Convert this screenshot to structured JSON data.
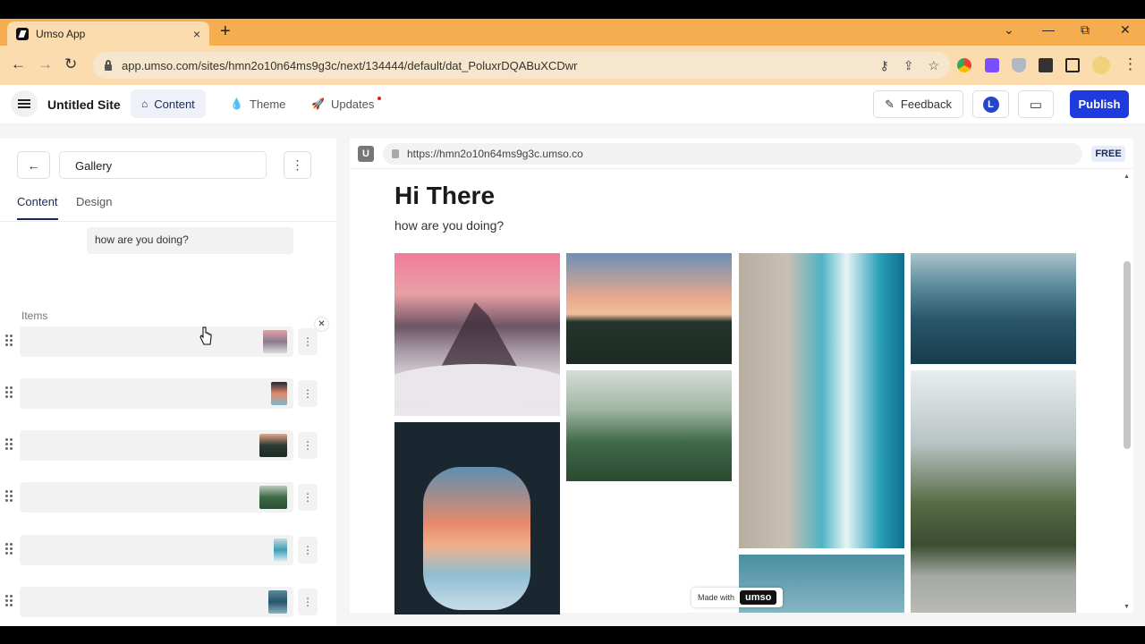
{
  "browser": {
    "tab_title": "Umso App",
    "tab_close": "×",
    "new_tab": "+",
    "url": "app.umso.com/sites/hmn2o10n64ms9g3c/next/134444/default/dat_PoluxrDQABuXCDwr",
    "win_min": "—",
    "win_restore": "⧉",
    "win_close": "✕",
    "tab_dropdown": "⌄"
  },
  "header": {
    "site_title": "Untitled Site",
    "tabs": [
      {
        "label": "Content",
        "icon": "home-icon"
      },
      {
        "label": "Theme",
        "icon": "droplet-icon"
      },
      {
        "label": "Updates",
        "icon": "rocket-icon"
      }
    ],
    "feedback_label": "Feedback",
    "avatar_initial": "L",
    "publish_label": "Publish"
  },
  "sidebar": {
    "section_name": "Gallery",
    "tabs": [
      "Content",
      "Design"
    ],
    "text_value": "how are you doing?",
    "items_label": "Items",
    "items": [
      {
        "thumb": "mountain-thumbnail",
        "colors": [
          "#e7a0a8",
          "#8a7a8a",
          "#ddd"
        ]
      },
      {
        "thumb": "window-thumbnail",
        "colors": [
          "#1c2730",
          "#e58a6a",
          "#7fb6cc"
        ]
      },
      {
        "thumb": "skate-thumbnail",
        "colors": [
          "#e9a886",
          "#2b3a33",
          "#1e2a25"
        ]
      },
      {
        "thumb": "forest-thumbnail",
        "colors": [
          "#b9c9bc",
          "#3f6a47",
          "#2c4d33"
        ]
      },
      {
        "thumb": "wave-thumbnail",
        "colors": [
          "#c9d9dd",
          "#3aa0b5",
          "#e6f2f4"
        ]
      },
      {
        "thumb": "sea-thumbnail",
        "colors": [
          "#5b8a9a",
          "#28546a",
          "#89b4c0"
        ]
      }
    ]
  },
  "preview": {
    "badge": "U",
    "url": "https://hmn2o10n64ms9g3c.umso.co",
    "plan": "FREE",
    "title": "Hi There",
    "subtitle": "how are you doing?",
    "made_with": "Made with",
    "brand": "umso"
  }
}
